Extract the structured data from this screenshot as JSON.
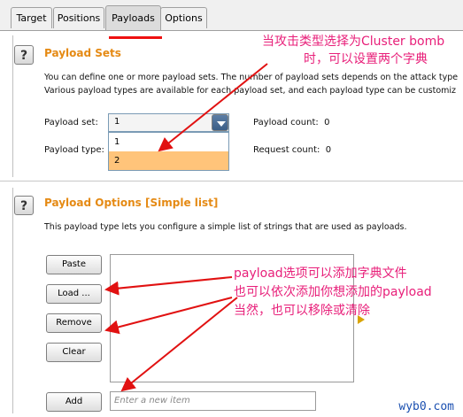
{
  "tabs": [
    {
      "label": "Target"
    },
    {
      "label": "Positions"
    },
    {
      "label": "Payloads"
    },
    {
      "label": "Options"
    }
  ],
  "active_tab": "Payloads",
  "payload_sets": {
    "title": "Payload Sets",
    "desc_line1": "You can define one or more payload sets. The number of payload sets depends on the attack type",
    "desc_line2": "Various payload types are available for each payload set, and each payload type can be customiz",
    "payload_set_label": "Payload set:",
    "payload_set_value": "1",
    "payload_set_options": [
      "1",
      "2"
    ],
    "payload_type_label": "Payload type:",
    "payload_count_label": "Payload count:",
    "payload_count_value": "0",
    "request_count_label": "Request count:",
    "request_count_value": "0"
  },
  "payload_options": {
    "title": "Payload Options [Simple list]",
    "desc": "This payload type lets you configure a simple list of strings that are used as payloads.",
    "buttons": {
      "paste": "Paste",
      "load": "Load ...",
      "remove": "Remove",
      "clear": "Clear",
      "add": "Add"
    },
    "new_item_placeholder": "Enter a new item"
  },
  "annotations": {
    "top_line1": "当攻击类型选择为Cluster bomb",
    "top_line2": "时，可以设置两个字典",
    "mid_line1": "payload选项可以添加字典文件",
    "mid_line2": "也可以依次添加你想添加的payload",
    "mid_line3": "当然，也可以移除或清除"
  },
  "watermark": "wyb0.com",
  "colors": {
    "section_title": "#e58a14",
    "annotation": "#e8207a",
    "selected_option": "#ffc47a",
    "arrow": "#e11111"
  }
}
